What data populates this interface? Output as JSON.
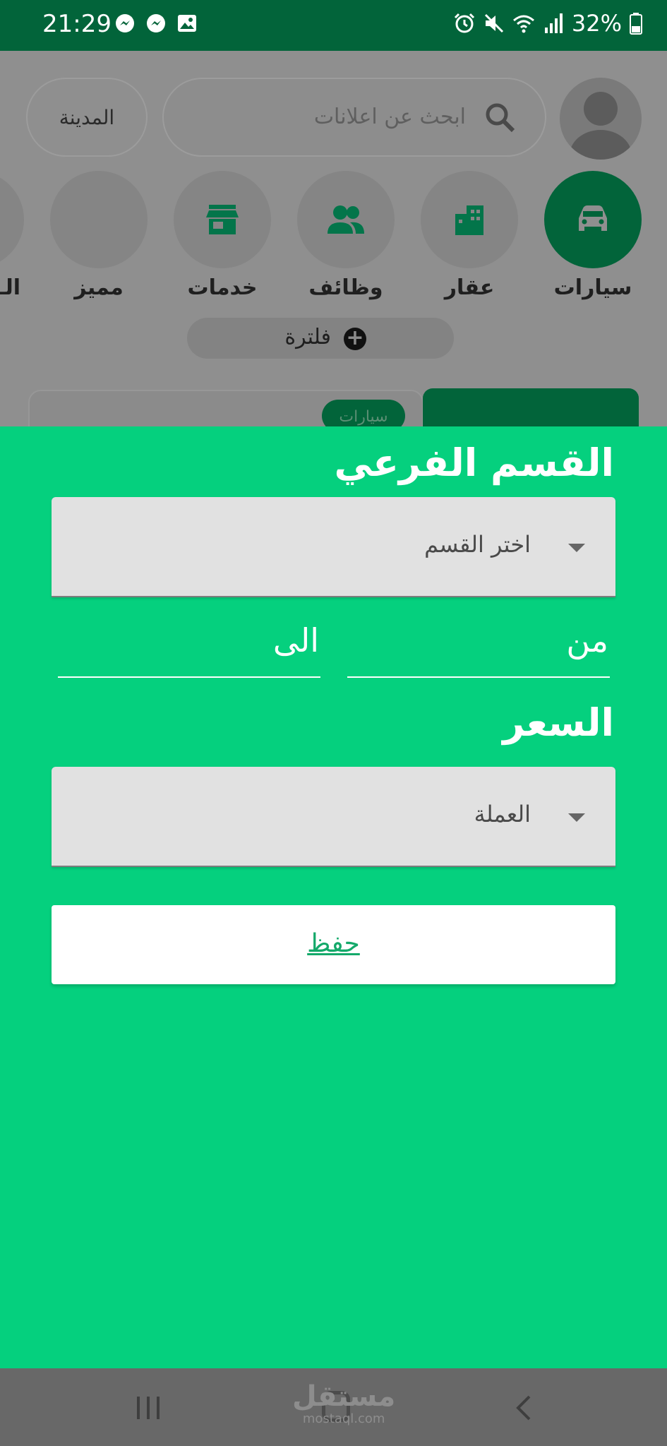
{
  "status_bar": {
    "time": "21:29",
    "battery": "32%",
    "notifications": [
      "messenger-icon",
      "messenger-icon",
      "image-icon"
    ],
    "system_icons": [
      "alarm-icon",
      "mute-icon",
      "wifi-icon",
      "signal-icon",
      "battery-icon"
    ]
  },
  "header": {
    "search_placeholder": "ابحث عن اعلانات",
    "city_label": "المدينة"
  },
  "categories": [
    {
      "label": "سيارات",
      "icon": "car-icon",
      "active": true
    },
    {
      "label": "عقار",
      "icon": "building-icon",
      "active": false
    },
    {
      "label": "وظائف",
      "icon": "people-icon",
      "active": false
    },
    {
      "label": "خدمات",
      "icon": "store-icon",
      "active": false
    },
    {
      "label": "مميز",
      "icon": "",
      "active": false
    },
    {
      "label": "الـ",
      "icon": "",
      "active": false
    }
  ],
  "filter": {
    "label": "فلترة"
  },
  "card": {
    "tag": "سيارات"
  },
  "sheet": {
    "subcategory_title": "القسم الفرعي",
    "subcategory_value": "اختر القسم",
    "from_label": "من",
    "to_label": "الى",
    "price_title": "السعر",
    "currency_value": "العملة",
    "save_label": "حفظ"
  },
  "watermark": {
    "arabic": "مستقل",
    "latin": "mostaql.com"
  },
  "colors": {
    "primary_dark": "#02643a",
    "sheet_green": "#05d07e",
    "dropdown_bg": "#e1e1e1"
  }
}
